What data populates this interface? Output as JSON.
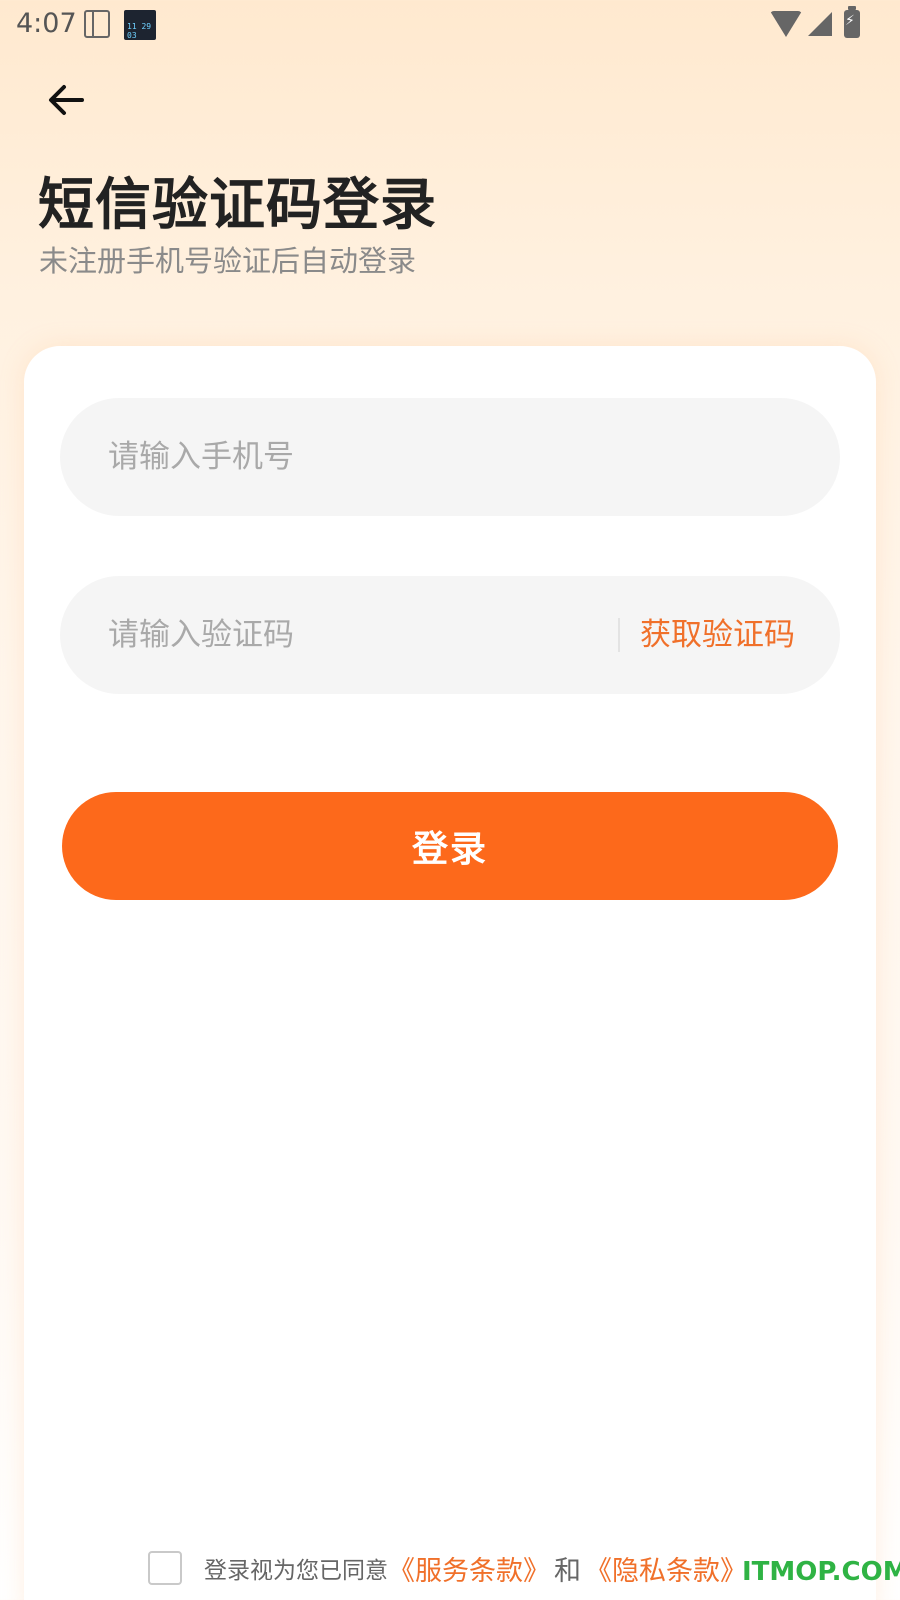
{
  "status_bar": {
    "time": "4:07",
    "notification_icons": [
      "notebook-icon",
      "clock-widget-icon"
    ],
    "system_icons": [
      "wifi-icon",
      "signal-icon",
      "battery-charging-icon"
    ]
  },
  "header": {
    "back_icon": "arrow-left-icon",
    "title": "短信验证码登录",
    "subtitle": "未注册手机号验证后自动登录"
  },
  "form": {
    "phone_placeholder": "请输入手机号",
    "phone_value": "",
    "code_placeholder": "请输入验证码",
    "code_value": "",
    "get_code_label": "获取验证码",
    "login_label": "登录"
  },
  "agreement": {
    "checked": false,
    "prefix": "登录视为您已同意",
    "terms_link": "《服务条款》",
    "and": "和",
    "privacy_link": "《隐私条款》"
  },
  "watermark": "ITMOP.COM",
  "colors": {
    "accent": "#fd691b",
    "link": "#f0702a",
    "title": "#222222",
    "input_bg": "#f5f5f5",
    "bg_top": "#ffe9cf"
  }
}
